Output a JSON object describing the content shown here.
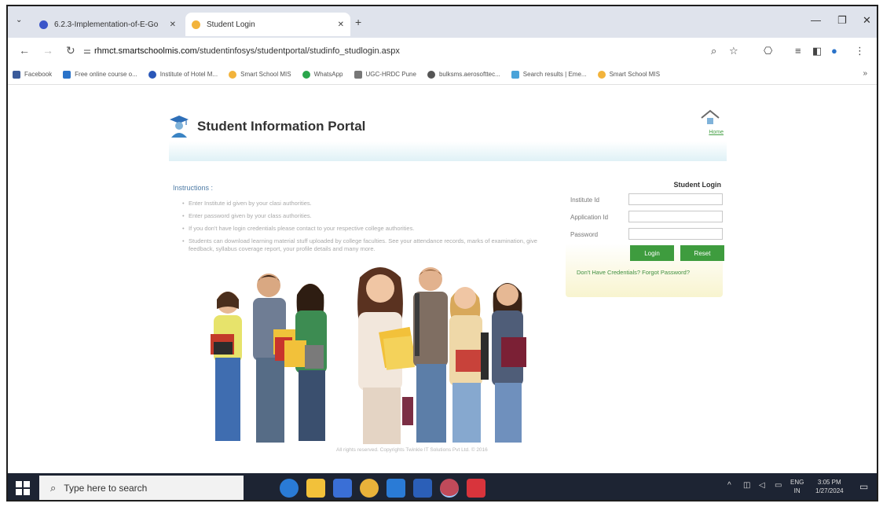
{
  "tabs": [
    {
      "title": "6.2.3-Implementation-of-E-Go",
      "favicon_color": "#3b55c9",
      "active": false
    },
    {
      "title": "Student Login",
      "favicon_color": "#f2b33b",
      "active": true
    }
  ],
  "address_bar": {
    "url_domain": "rhmct.smartschoolmis.com",
    "url_path": "/studentinfosys/studentportal/studinfo_studlogin.aspx"
  },
  "bookmarks": [
    {
      "label": "Facebook",
      "color": "#3b5b9a"
    },
    {
      "label": "Free online course o...",
      "color": "#2a73c9"
    },
    {
      "label": "Institute of Hotel M...",
      "color": "#2a57b8"
    },
    {
      "label": "Smart School MIS",
      "color": "#f2b33b"
    },
    {
      "label": "WhatsApp",
      "color": "#2aa64b"
    },
    {
      "label": "UGC-HRDC Pune",
      "color": "#777777"
    },
    {
      "label": "bulksms.aerosofttec...",
      "color": "#555555"
    },
    {
      "label": "Search results | Eme...",
      "color": "#4aa3d9"
    },
    {
      "label": "Smart School MIS",
      "color": "#f2b33b"
    }
  ],
  "portal": {
    "title": "Student Information Portal",
    "home_label": "Home"
  },
  "instructions": {
    "title": "Instructions :",
    "items": [
      "Enter Institute id given by your clasi authorities.",
      "Enter password given by your class authorities.",
      "If you don't have login credentials please contact to your respective college authorities.",
      "Students can download learning material stuff uploaded by college faculties. See your attendance records, marks of examination, give feedback, syllabus coverage report, your profile details and many more."
    ]
  },
  "login": {
    "heading": "Student Login",
    "institute_label": "Institute Id",
    "application_label": "Application Id",
    "password_label": "Password",
    "login_button": "Login",
    "reset_button": "Reset",
    "credentials_link": "Don't Have Credentials? Forgot Password?",
    "accent": "#3e9c3e"
  },
  "footer": "All rights reserved. Copyrights Twinkle IT Solutions Pvt Ltd. © 2016",
  "taskbar": {
    "search_placeholder": "Type here to search",
    "lang_top": "ENG",
    "lang_bottom": "IN",
    "time": "3:05 PM",
    "date": "1/27/2024"
  }
}
